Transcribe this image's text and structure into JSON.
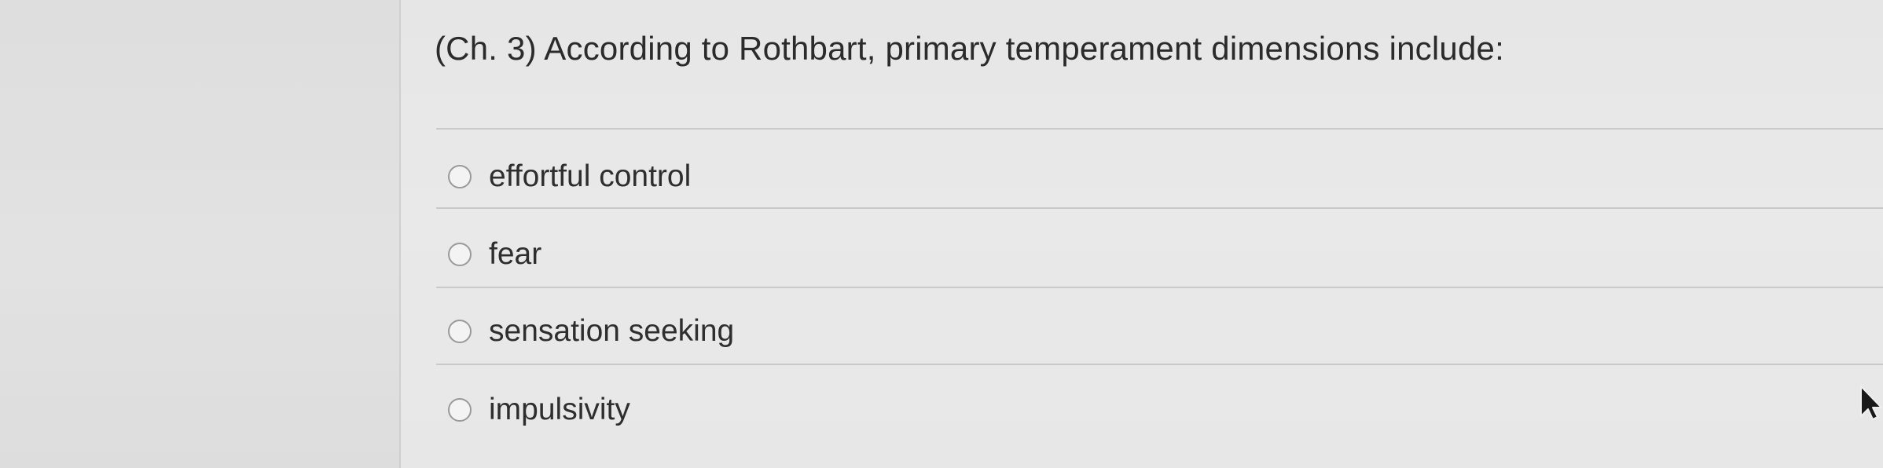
{
  "question": {
    "text": "(Ch. 3) According to Rothbart, primary temperament dimensions include:"
  },
  "options": [
    {
      "label": "effortful control",
      "selected": false
    },
    {
      "label": "fear",
      "selected": false
    },
    {
      "label": "sensation seeking",
      "selected": false
    },
    {
      "label": "impulsivity",
      "selected": false
    }
  ],
  "colors": {
    "text": "#2b2b2b",
    "radio_border": "#9a9a9a",
    "divider": "#c9c9c9",
    "background": "#e6e6e6"
  }
}
